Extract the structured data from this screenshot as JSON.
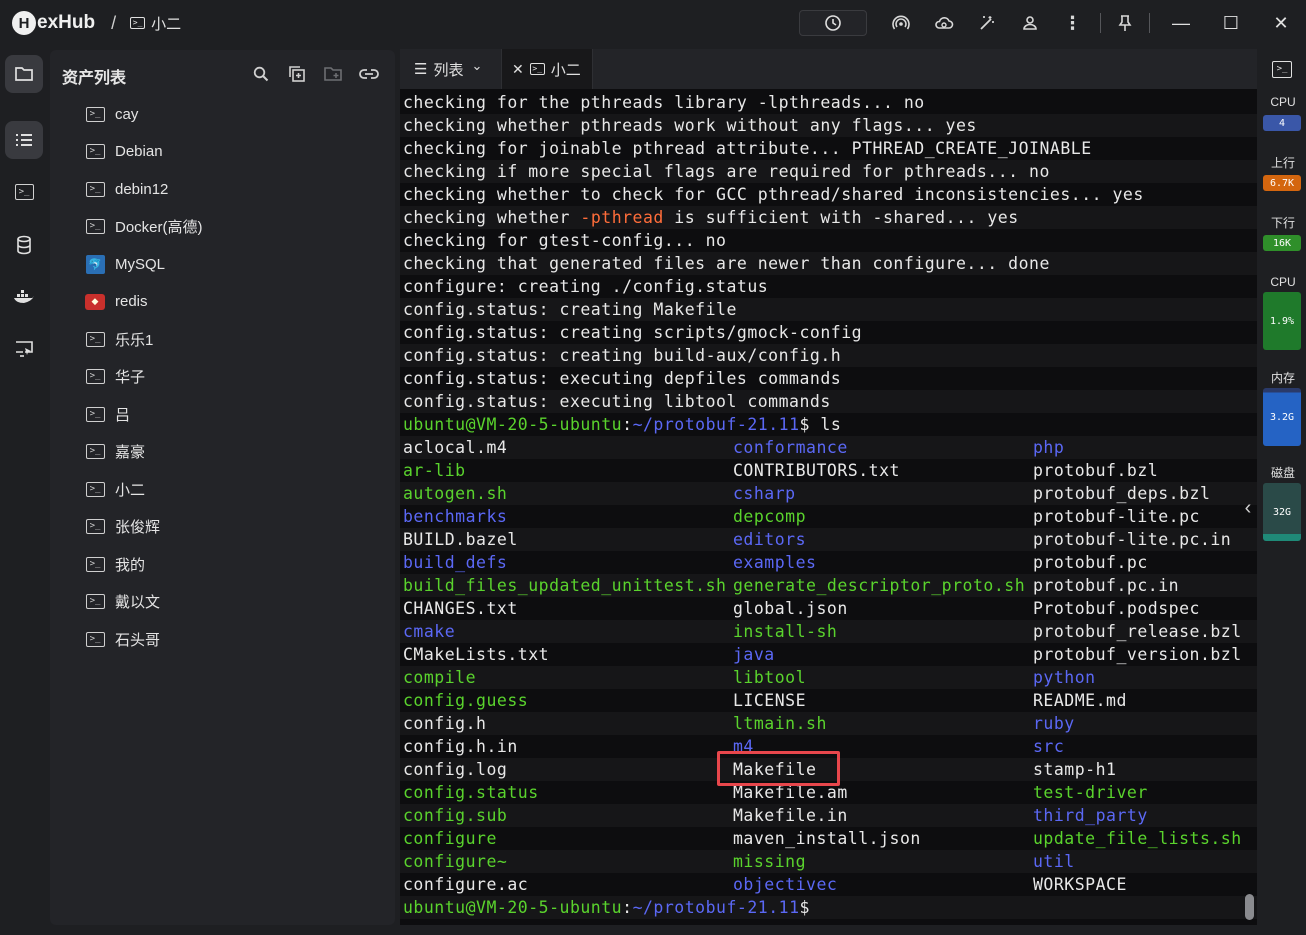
{
  "app": {
    "logo_letter": "H",
    "logo_text": "exHub",
    "breadcrumb_sep": "/",
    "breadcrumb_current": "小二"
  },
  "titlebar_icons": [
    "status-icon",
    "broadcast-icon",
    "cloud-sync-icon",
    "magic-wand-icon",
    "user-icon",
    "more-vertical-icon",
    "pin-icon"
  ],
  "window_controls": {
    "minimize": "—",
    "maximize": "☐",
    "close": "✕"
  },
  "left_rail": [
    "folder-icon",
    "list-icon",
    "terminal-icon",
    "database-icon",
    "docker-icon",
    "remote-desktop-icon"
  ],
  "assets": {
    "title": "资产列表",
    "items": [
      {
        "label": "cay",
        "icon": "terminal"
      },
      {
        "label": "Debian",
        "icon": "terminal"
      },
      {
        "label": "debin12",
        "icon": "terminal"
      },
      {
        "label": "Docker(高德)",
        "icon": "terminal"
      },
      {
        "label": "MySQL",
        "icon": "mysql"
      },
      {
        "label": "redis",
        "icon": "redis"
      },
      {
        "label": "乐乐1",
        "icon": "terminal"
      },
      {
        "label": "华子",
        "icon": "terminal"
      },
      {
        "label": "吕",
        "icon": "terminal"
      },
      {
        "label": "嘉豪",
        "icon": "terminal"
      },
      {
        "label": "小二",
        "icon": "terminal"
      },
      {
        "label": "张俊辉",
        "icon": "terminal"
      },
      {
        "label": "我的",
        "icon": "terminal"
      },
      {
        "label": "戴以文",
        "icon": "terminal"
      },
      {
        "label": "石头哥",
        "icon": "terminal"
      }
    ]
  },
  "tabs": {
    "list_tab": "列表",
    "list_chevron": "⌄",
    "close_glyph": "✕",
    "session_tab": "小二"
  },
  "terminal": {
    "output_lines": [
      "checking for the pthreads library -lpthreads... no",
      "checking whether pthreads work without any flags... yes",
      "checking for joinable pthread attribute... PTHREAD_CREATE_JOINABLE",
      "checking if more special flags are required for pthreads... no",
      "checking whether to check for GCC pthread/shared inconsistencies... yes",
      "checking whether ",
      "checking for gtest-config... no",
      "checking that generated files are newer than configure... done",
      "configure: creating ./config.status",
      "config.status: creating Makefile",
      "config.status: creating scripts/gmock-config",
      "config.status: creating build-aux/config.h",
      "config.status: executing depfiles commands",
      "config.status: executing libtool commands"
    ],
    "line6_flag": "-pthread",
    "line6_rest": " is sufficient with -shared... yes",
    "prompt_user": "ubuntu@VM-20-5-ubuntu",
    "prompt_colon": ":",
    "prompt_path": "~/protobuf-21.11",
    "prompt_dollar": "$",
    "command": " ls",
    "ls_col1": [
      {
        "name": "aclocal.m4",
        "color": "white"
      },
      {
        "name": "ar-lib",
        "color": "green"
      },
      {
        "name": "autogen.sh",
        "color": "green"
      },
      {
        "name": "benchmarks",
        "color": "blue"
      },
      {
        "name": "BUILD.bazel",
        "color": "white"
      },
      {
        "name": "build_defs",
        "color": "blue"
      },
      {
        "name": "build_files_updated_unittest.sh",
        "color": "green"
      },
      {
        "name": "CHANGES.txt",
        "color": "white"
      },
      {
        "name": "cmake",
        "color": "blue"
      },
      {
        "name": "CMakeLists.txt",
        "color": "white"
      },
      {
        "name": "compile",
        "color": "green"
      },
      {
        "name": "config.guess",
        "color": "green"
      },
      {
        "name": "config.h",
        "color": "white"
      },
      {
        "name": "config.h.in",
        "color": "white"
      },
      {
        "name": "config.log",
        "color": "white"
      },
      {
        "name": "config.status",
        "color": "green"
      },
      {
        "name": "config.sub",
        "color": "green"
      },
      {
        "name": "configure",
        "color": "green"
      },
      {
        "name": "configure~",
        "color": "green"
      },
      {
        "name": "configure.ac",
        "color": "white"
      }
    ],
    "ls_col2": [
      {
        "name": "conformance",
        "color": "blue"
      },
      {
        "name": "CONTRIBUTORS.txt",
        "color": "white"
      },
      {
        "name": "csharp",
        "color": "blue"
      },
      {
        "name": "depcomp",
        "color": "green"
      },
      {
        "name": "editors",
        "color": "blue"
      },
      {
        "name": "examples",
        "color": "blue"
      },
      {
        "name": "generate_descriptor_proto.sh",
        "color": "green"
      },
      {
        "name": "global.json",
        "color": "white"
      },
      {
        "name": "install-sh",
        "color": "green"
      },
      {
        "name": "java",
        "color": "blue"
      },
      {
        "name": "libtool",
        "color": "green"
      },
      {
        "name": "LICENSE",
        "color": "white"
      },
      {
        "name": "ltmain.sh",
        "color": "green"
      },
      {
        "name": "m4",
        "color": "blue"
      },
      {
        "name": "Makefile",
        "color": "white"
      },
      {
        "name": "Makefile.am",
        "color": "white"
      },
      {
        "name": "Makefile.in",
        "color": "white"
      },
      {
        "name": "maven_install.json",
        "color": "white"
      },
      {
        "name": "missing",
        "color": "green"
      },
      {
        "name": "objectivec",
        "color": "blue"
      }
    ],
    "ls_col3": [
      {
        "name": "php",
        "color": "blue"
      },
      {
        "name": "protobuf.bzl",
        "color": "white"
      },
      {
        "name": "protobuf_deps.bzl",
        "color": "white"
      },
      {
        "name": "protobuf-lite.pc",
        "color": "white"
      },
      {
        "name": "protobuf-lite.pc.in",
        "color": "white"
      },
      {
        "name": "protobuf.pc",
        "color": "white"
      },
      {
        "name": "protobuf.pc.in",
        "color": "white"
      },
      {
        "name": "Protobuf.podspec",
        "color": "white"
      },
      {
        "name": "protobuf_release.bzl",
        "color": "white"
      },
      {
        "name": "protobuf_version.bzl",
        "color": "white"
      },
      {
        "name": "python",
        "color": "blue"
      },
      {
        "name": "README.md",
        "color": "white"
      },
      {
        "name": "ruby",
        "color": "blue"
      },
      {
        "name": "src",
        "color": "blue"
      },
      {
        "name": "stamp-h1",
        "color": "white"
      },
      {
        "name": "test-driver",
        "color": "green"
      },
      {
        "name": "third_party",
        "color": "blue"
      },
      {
        "name": "update_file_lists.sh",
        "color": "green"
      },
      {
        "name": "util",
        "color": "blue"
      },
      {
        "name": "WORKSPACE",
        "color": "white"
      }
    ],
    "highlighted_file": "Makefile"
  },
  "monitor": {
    "cpu_cores_label": "CPU",
    "cpu_cores_value": "4",
    "upload_label": "上行",
    "upload_value": "6.7K",
    "download_label": "下行",
    "download_value": "16K",
    "cpu_usage_label": "CPU",
    "cpu_usage_value": "1.9%",
    "cpu_usage_fraction": 0.019,
    "memory_label": "内存",
    "memory_value": "3.2G",
    "disk_label": "磁盘",
    "disk_value": "32G",
    "collapse_glyph": "‹"
  },
  "colors": {
    "green": "#5ad32d",
    "blue": "#5b68f5",
    "orange": "#ff6d3a",
    "white": "#e8e8e8",
    "highlight": "#e8474c",
    "upload_badge": "#d4660f",
    "download_badge": "#2f8f2a",
    "cpu_badge": "#3a57a8"
  }
}
